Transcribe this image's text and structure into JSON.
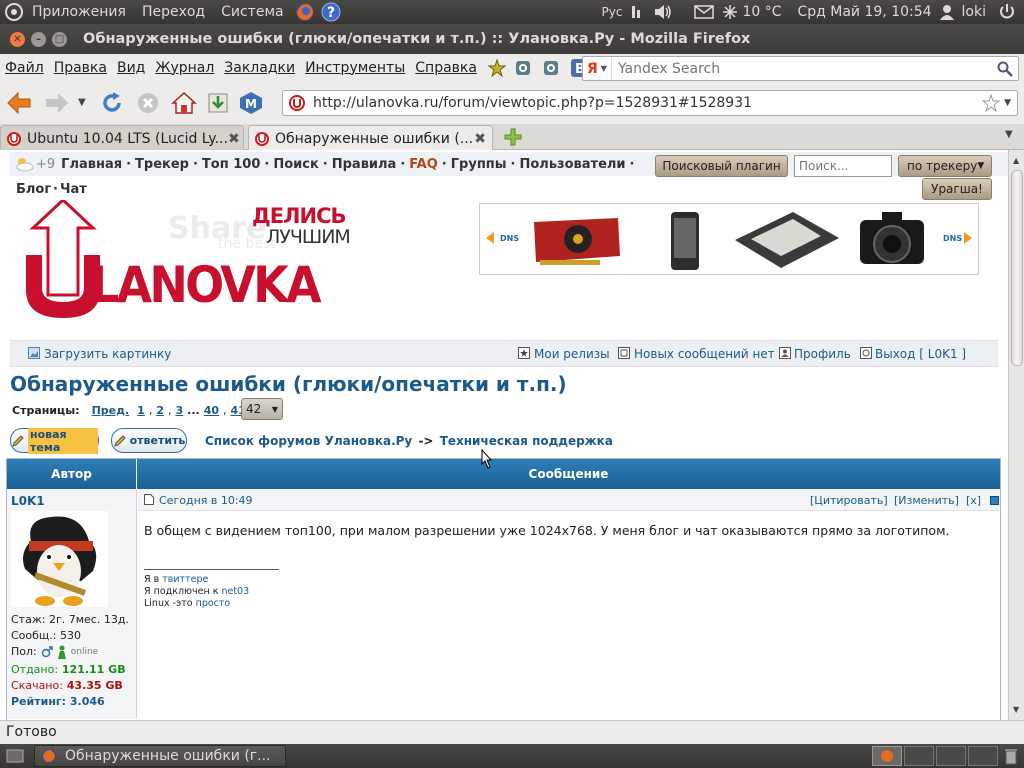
{
  "topbar": {
    "menu": [
      "Приложения",
      "Переход",
      "Система"
    ],
    "keyboard": "Рус",
    "weather": "10 °C",
    "datetime": "Срд Май 19, 10:54",
    "user": "loki"
  },
  "window": {
    "title": "Обнаруженные ошибки (глюки/опечатки и т.п.) :: Улановка.Ру - Mozilla Firefox"
  },
  "menubar": {
    "items": [
      "Файл",
      "Правка",
      "Вид",
      "Журнал",
      "Закладки",
      "Инструменты",
      "Справка"
    ]
  },
  "search": {
    "placeholder": "Yandex Search",
    "engine_letter": "Я"
  },
  "url": "http://ulanovka.ru/forum/viewtopic.php?p=1528931#1528931",
  "tabs": [
    {
      "label": "Ubuntu 10.04 LTS (Lucid Ly...",
      "active": false
    },
    {
      "label": "Обнаруженные ошибки (...",
      "active": true
    }
  ],
  "site": {
    "weather_mini": "+9",
    "nav": [
      "Главная",
      "Трекер",
      "Топ 100",
      "Поиск",
      "Правила",
      "FAQ",
      "Группы",
      "Пользователи"
    ],
    "nav_sep": "·",
    "search_plugin": "Поисковый плагин",
    "search_placeholder": "Поиск...",
    "search_scope": "по трекеру",
    "blog": "Блог",
    "chat": "Чат",
    "uragsha": "Урагша!",
    "logo_main": "LANOVKA",
    "logo_slogan1": "ДЕЛИСЬ",
    "logo_slogan2": "ЛУЧШИМ",
    "banner_left": "DNS",
    "banner_right": "DNS",
    "toolbar": {
      "upload": "Загрузить картинку",
      "my_releases": "Мои релизы",
      "new_messages": "Новых сообщений нет",
      "profile": "Профиль",
      "logout": "Выход [ L0K1 ]"
    },
    "topic_title": "Обнаруженные ошибки (глюки/опечатки и т.п.)",
    "pages_label": "Страницы:",
    "pages": {
      "prev": "Пред.",
      "p1": "1",
      "p2": "2",
      "p3": "3",
      "ellipsis": "...",
      "p40": "40",
      "p41": "41",
      "current": "42",
      "select": "42"
    },
    "btn_new_topic": "новая тема",
    "btn_reply": "ответить",
    "crumb_forums": "Список форумов Улановка.Ру",
    "crumb_arrow": "->",
    "crumb_section": "Техническая поддержка",
    "col_author": "Автор",
    "col_message": "Сообщение"
  },
  "post": {
    "author": "L0K1",
    "stats": {
      "staz": "Стаж: 2г. 7мес. 13д.",
      "msgs": "Сообщ.: 530",
      "pol": "Пол:",
      "online": "online",
      "otdano_label": "Отдано:",
      "otdano": "121.11 GB",
      "skachano_label": "Скачано:",
      "skachano": "43.35 GB",
      "rating_label": "Рейтинг:",
      "rating": "3.046"
    },
    "time": "Сегодня в 10:49",
    "actions": {
      "quote": "[Цитировать]",
      "edit": "[Изменить]",
      "del": "[x]"
    },
    "text": "В общем с видением топ100, при малом разрешении уже 1024x768. У меня блог и чат оказываются прямо за логотипом.",
    "sig": {
      "line1a": "Я в ",
      "line1b": "твиттере",
      "line2a": "Я подключен к ",
      "line2b": "net03",
      "line3a": "Linux -это ",
      "line3b": "просто"
    }
  },
  "status": "Готово",
  "taskbar": {
    "window": "Обнаруженные ошибки (г..."
  },
  "colors": {
    "panel": "#3c3b37",
    "accent_orange": "#f07746",
    "link": "#1c5a8b",
    "header_blue": "#1b5f94",
    "otdano": "#1a8a1a",
    "skachano": "#b01010"
  }
}
